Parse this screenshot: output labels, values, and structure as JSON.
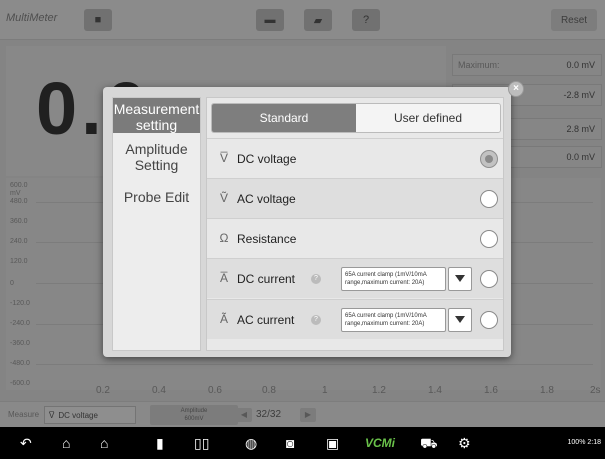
{
  "app": {
    "title": "MultiMeter",
    "reset_label": "Reset",
    "reading_value": "0.0",
    "stats": [
      {
        "label": "Maximum:",
        "value": "0.0 mV"
      },
      {
        "label": "",
        "value": "-2.8 mV"
      },
      {
        "label": "",
        "value": "2.8 mV"
      },
      {
        "label": "",
        "value": "0.0 mV"
      }
    ],
    "graph": {
      "y_ticks": [
        "600.0",
        "480.0",
        "360.0",
        "240.0",
        "120.0",
        "0",
        "-120.0",
        "-240.0",
        "-360.0",
        "-480.0",
        "-600.0"
      ],
      "y_unit": "mV",
      "x_ticks": [
        "0.2",
        "0.4",
        "0.6",
        "0.8",
        "1",
        "1.2",
        "1.4",
        "1.6",
        "1.8",
        "2s"
      ]
    },
    "bottom": {
      "measure_label": "Measure",
      "measure_value": "DC voltage",
      "amplitude_label": "Amplitude",
      "amplitude_value": "600mV",
      "page_indicator": "32/32"
    }
  },
  "dialog": {
    "nav": {
      "measurement": "Measurement setting",
      "amplitude": "Amplitude Setting",
      "probe": "Probe Edit"
    },
    "tabs": {
      "standard": "Standard",
      "user_defined": "User defined"
    },
    "options": [
      {
        "label": "DC voltage",
        "symbol": "V̅",
        "selected": true
      },
      {
        "label": "AC voltage",
        "symbol": "Ṽ",
        "selected": false
      },
      {
        "label": "Resistance",
        "symbol": "Ω",
        "selected": false
      },
      {
        "label": "DC current",
        "symbol": "A̅",
        "selected": false,
        "clamp": "65A current clamp (1mV/10mA range,maximum current: 20A)"
      },
      {
        "label": "AC current",
        "symbol": "Ã",
        "selected": false,
        "clamp": "65A current clamp (1mV/10mA range,maximum current: 20A)"
      }
    ]
  },
  "status_bar": {
    "battery": "100%",
    "time": "2:18"
  },
  "colors": {
    "active_nav": "#7b7b7b",
    "active_tab": "#7e7e7e",
    "dialog_bg": "#d7d7d7"
  }
}
